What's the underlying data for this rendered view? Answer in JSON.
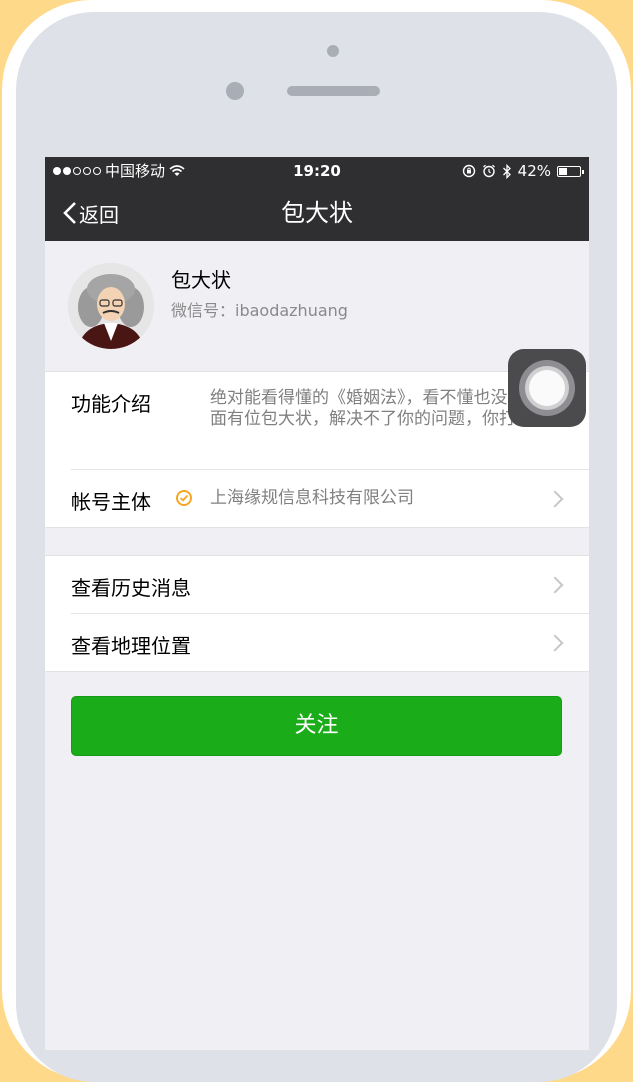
{
  "status_bar": {
    "signal_dots_filled": 2,
    "signal_dots_total": 5,
    "carrier": "中国移动",
    "time": "19:20",
    "battery": "42%",
    "battery_level": 0.42,
    "icons": [
      "wifi-icon",
      "rotation-lock-icon",
      "alarm-icon",
      "bluetooth-icon",
      "battery-icon"
    ]
  },
  "nav": {
    "back_label": "返回",
    "title": "包大状"
  },
  "profile": {
    "name": "包大状",
    "wechat_id": "微信号：ibaodazhuang"
  },
  "info": {
    "intro_label": "功能介绍",
    "intro_text": "绝对能看得懂的《婚姻法》，看不懂也没关系~里面有位包大状，解决不了你的问题，你打他~",
    "entity_label": "帐号主体",
    "entity_value": "上海缘规信息科技有限公司"
  },
  "actions": {
    "history_label": "查看历史消息",
    "location_label": "查看地理位置"
  },
  "follow_button": "关注",
  "colors": {
    "nav_bg": "#2F2F31",
    "screen_bg": "#EFEFF4",
    "follow_green": "#1AAD19",
    "verify_orange": "#F5A623",
    "frame_yellow": "#FFD98A"
  }
}
